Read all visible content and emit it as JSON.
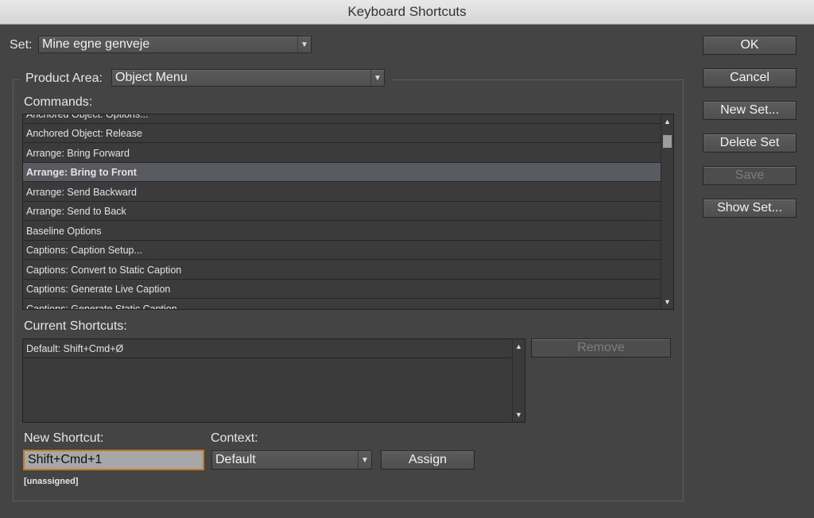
{
  "window": {
    "title": "Keyboard Shortcuts"
  },
  "set": {
    "label": "Set:",
    "value": "Mine egne genveje"
  },
  "product_area": {
    "label": "Product Area:",
    "value": "Object Menu"
  },
  "commands": {
    "label": "Commands:",
    "items": [
      "Anchored Object: Options...",
      "Anchored Object: Release",
      "Arrange: Bring Forward",
      "Arrange: Bring to Front",
      "Arrange: Send Backward",
      "Arrange: Send to Back",
      "Baseline Options",
      "Captions: Caption Setup...",
      "Captions: Convert to Static Caption",
      "Captions: Generate Live Caption",
      "Captions: Generate Static Caption"
    ],
    "selected": "Arrange: Bring to Front"
  },
  "current_shortcuts": {
    "label": "Current Shortcuts:",
    "items": [
      "Default: Shift+Cmd+Ø"
    ],
    "remove_label": "Remove"
  },
  "new_shortcut": {
    "label": "New Shortcut:",
    "value": "Shift+Cmd+1",
    "status": "[unassigned]"
  },
  "context": {
    "label": "Context:",
    "value": "Default"
  },
  "assign_label": "Assign",
  "buttons": {
    "ok": "OK",
    "cancel": "Cancel",
    "new_set": "New Set...",
    "delete_set": "Delete Set",
    "save": "Save",
    "show_set": "Show Set..."
  },
  "colors": {
    "background": "#444444",
    "selected_row": "#575a5e",
    "focus_ring": "#c27a2a"
  },
  "icons": {
    "dropdown": "chevron-down-icon",
    "scroll_up": "scroll-up-icon",
    "scroll_down": "scroll-down-icon"
  }
}
